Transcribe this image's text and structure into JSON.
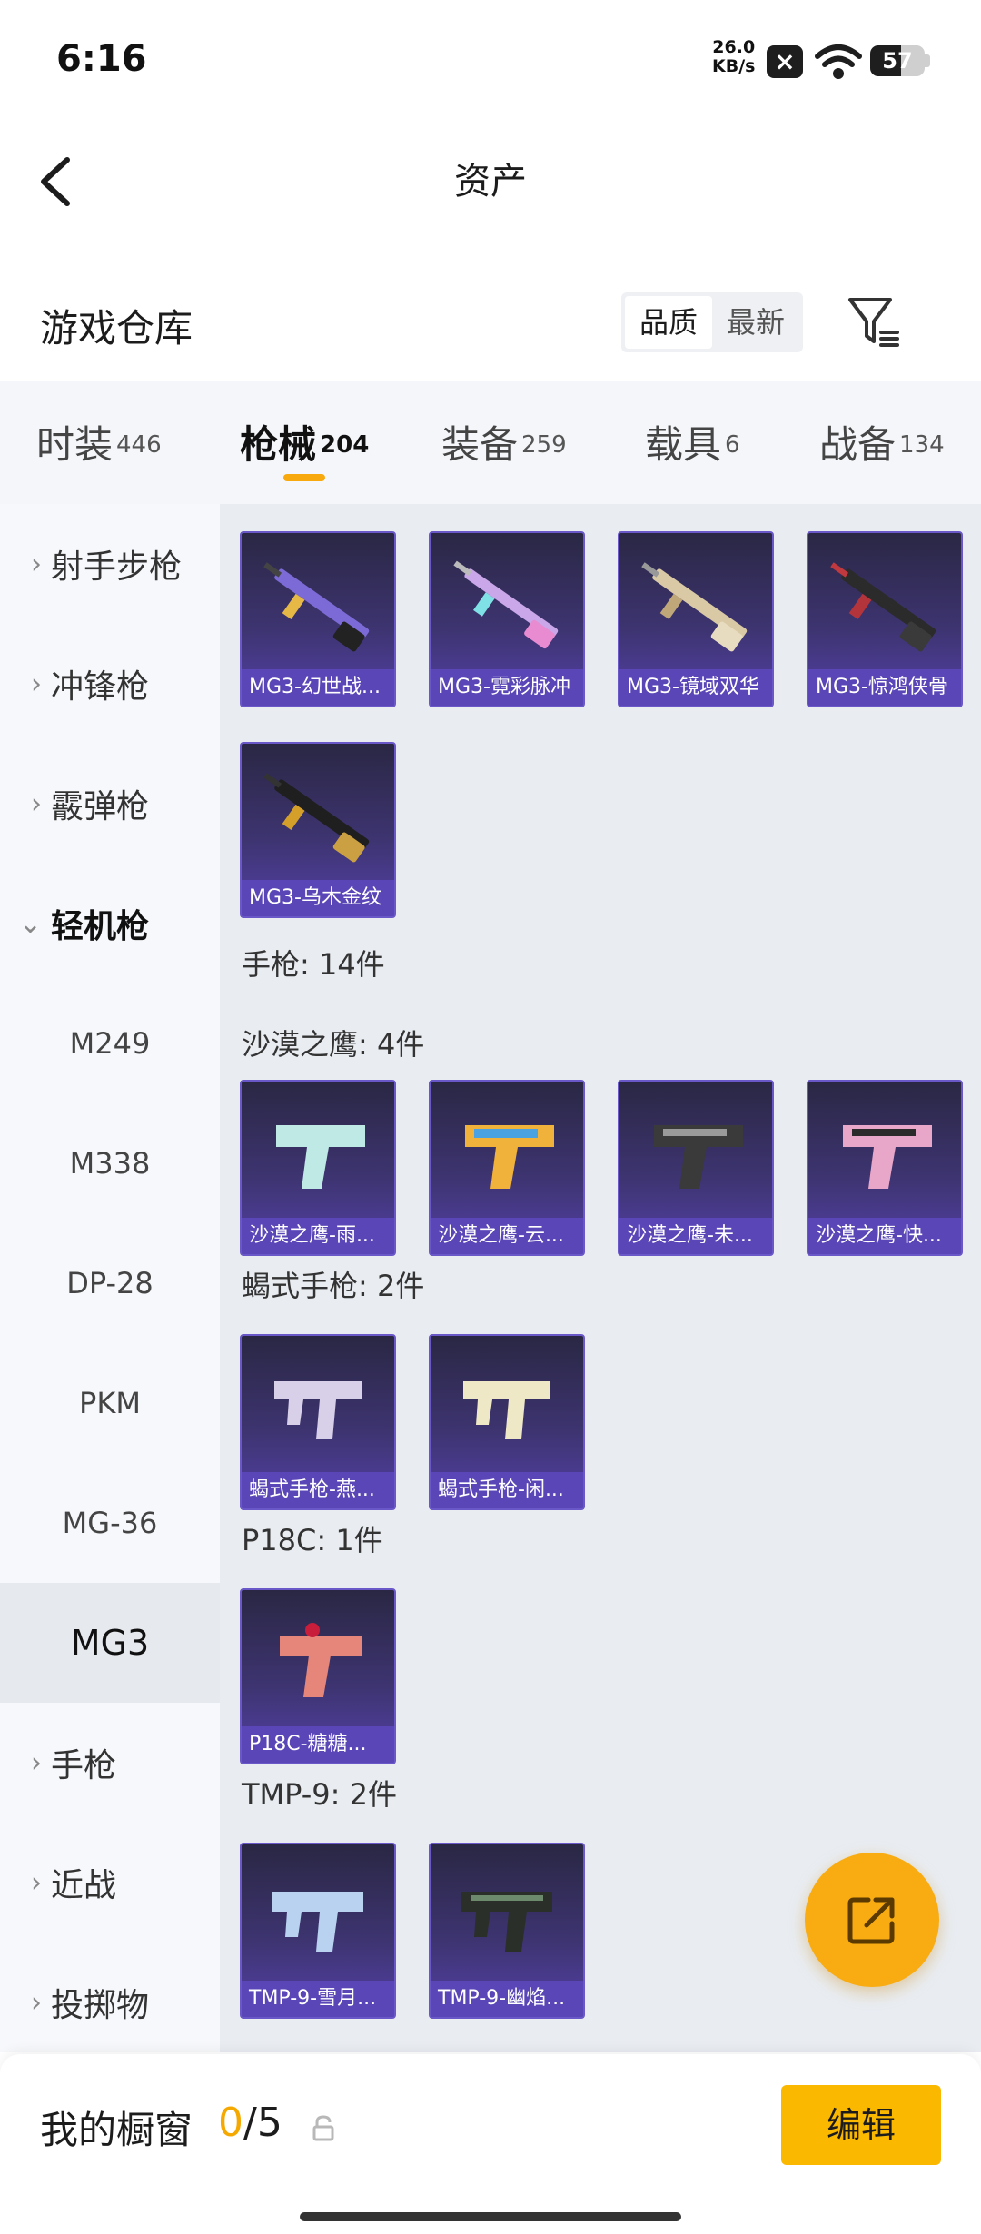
{
  "status_bar": {
    "time": "6:16",
    "net_speed_value": "26.0",
    "net_speed_unit": "KB/s",
    "battery": "57"
  },
  "title_bar": {
    "title": "资产"
  },
  "warehouse": {
    "title": "游戏仓库",
    "sort": [
      "品质",
      "最新"
    ],
    "sort_active": "品质"
  },
  "categories": [
    {
      "label": "时装",
      "count": "446"
    },
    {
      "label": "枪械",
      "count": "204",
      "active": true
    },
    {
      "label": "装备",
      "count": "259"
    },
    {
      "label": "载具",
      "count": "6"
    },
    {
      "label": "战备",
      "count": "134"
    }
  ],
  "sidebar": {
    "groups_top": [
      "射手步枪",
      "冲锋枪",
      "霰弹枪"
    ],
    "expanded": "轻机枪",
    "sub_items": [
      "M249",
      "M338",
      "DP-28",
      "PKM",
      "MG-36",
      "MG3"
    ],
    "active_sub": "MG3",
    "groups_bottom": [
      "手枪",
      "近战",
      "投掷物"
    ]
  },
  "content": {
    "mg3_items": [
      "MG3-幻世战...",
      "MG3-霓彩脉冲",
      "MG3-镜域双华",
      "MG3-惊鸿侠骨",
      "MG3-乌木金纹"
    ],
    "pistol_header": "手枪: 14件",
    "deagle_header": "沙漠之鹰: 4件",
    "deagle_items": [
      "沙漠之鹰-雨...",
      "沙漠之鹰-云...",
      "沙漠之鹰-未...",
      "沙漠之鹰-快..."
    ],
    "scorpion_header": "蝎式手枪: 2件",
    "scorpion_items": [
      "蝎式手枪-燕...",
      "蝎式手枪-闲..."
    ],
    "p18c_header": "P18C: 1件",
    "p18c_items": [
      "P18C-糖糖..."
    ],
    "tmp_header": "TMP-9: 2件",
    "tmp_items": [
      "TMP-9-雪月...",
      "TMP-9-幽焰..."
    ]
  },
  "showcase": {
    "title": "我的橱窗",
    "current": "0",
    "max": "5",
    "edit_label": "编辑"
  }
}
